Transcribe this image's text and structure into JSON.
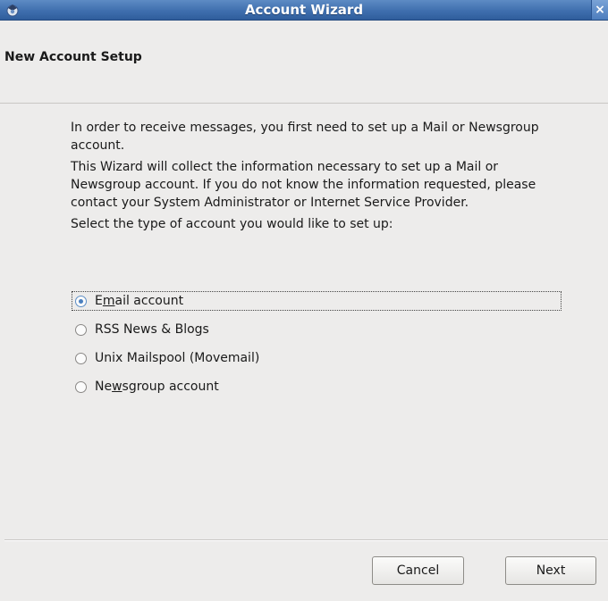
{
  "window": {
    "title": "Account Wizard",
    "close_glyph": "×",
    "app_icon": "thunderbird-icon"
  },
  "header": {
    "title": "New Account Setup"
  },
  "content": {
    "para1": "In order to receive messages, you first need to set up a Mail or Newsgroup account.",
    "para2": "This Wizard will collect the information necessary to set up a Mail or Newsgroup account. If you do not know the information requested, please contact your System Administrator or Internet Service Provider.",
    "para3": "Select the type of account you would like to set up:"
  },
  "options": [
    {
      "pre": "E",
      "accel": "m",
      "post": "ail account",
      "selected": true
    },
    {
      "pre": "RSS News & Blogs",
      "accel": "",
      "post": "",
      "selected": false
    },
    {
      "pre": "Unix Mailspool (Movemail)",
      "accel": "",
      "post": "",
      "selected": false
    },
    {
      "pre": "Ne",
      "accel": "w",
      "post": "sgroup account",
      "selected": false
    }
  ],
  "buttons": {
    "cancel": "Cancel",
    "next": "Next"
  },
  "colors": {
    "titlebar": "#3f6fae",
    "radio_selected": "#4a7fbf",
    "background": "#edeceb"
  }
}
